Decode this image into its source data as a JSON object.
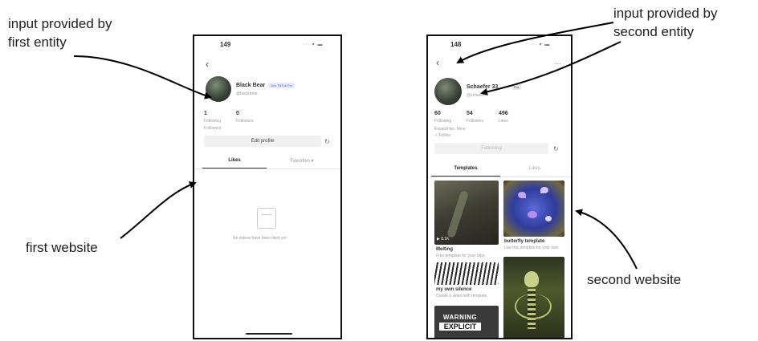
{
  "captions": {
    "input_first": "input provided by\nfirst entity",
    "input_second": "input provided by\nsecond entity",
    "first_website": "first website",
    "second_website": "second website"
  },
  "phone1": {
    "time": "149",
    "status_icons": "∙∙∙ ▾ ▬",
    "back": "‹",
    "username": "Black Bear",
    "badge": "Join TikTok Pro",
    "handle": "@blackbear",
    "stats": [
      {
        "value": "1",
        "label": "Following"
      },
      {
        "value": "0",
        "label": "Followers"
      }
    ],
    "stat3_label": "Followers",
    "edit_button": "Edit profile",
    "tab_active": "Likes",
    "tab_other": "Favorites ▾",
    "empty_text": "No videos have been liked yet"
  },
  "phone2": {
    "time": "148",
    "status_icons": "∙∙∙ ▾ ▬",
    "back": "‹",
    "more": "···",
    "username": "Schaefer 33",
    "badge": "Pro",
    "handle": "@schaefer",
    "stats": [
      {
        "value": "60",
        "label": "Following"
      },
      {
        "value": "54",
        "label": "Followers"
      },
      {
        "value": "496",
        "label": "Likes"
      }
    ],
    "bio": "Expand bio. Mine",
    "bio2": "✓ Follow",
    "follow_button": "Following",
    "tab_active": "Templates",
    "tab_other": "Likes",
    "tiles": [
      {
        "title": "Melting",
        "sub": "Free template for your clips",
        "count": "▶ 8.1K"
      },
      {
        "title": "butterfly template",
        "sub": "Use this template for your own"
      },
      {
        "title": "my own silence",
        "sub": "Create a video with template"
      },
      {
        "title": "",
        "sub": ""
      }
    ],
    "warning_text": "WARNING",
    "explicit_text": "EXPLICIT"
  }
}
